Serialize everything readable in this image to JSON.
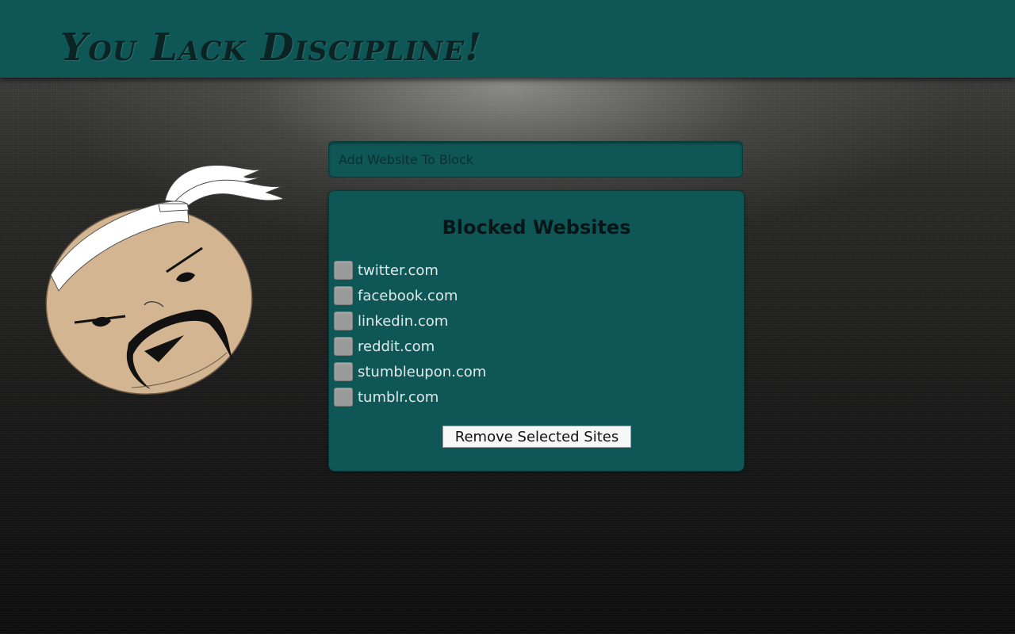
{
  "header": {
    "title": "You Lack Discipline!"
  },
  "mascot": {
    "icon": "angry-sensei-mascot-icon"
  },
  "add_site": {
    "placeholder": "Add Website To Block"
  },
  "blocked": {
    "title": "Blocked Websites",
    "sites": [
      {
        "label": "twitter.com",
        "checked": false
      },
      {
        "label": "facebook.com",
        "checked": false
      },
      {
        "label": "linkedin.com",
        "checked": false
      },
      {
        "label": "reddit.com",
        "checked": false
      },
      {
        "label": "stumbleupon.com",
        "checked": false
      },
      {
        "label": "tumblr.com",
        "checked": false
      }
    ],
    "remove_button_label": "Remove Selected Sites"
  },
  "colors": {
    "accent": "#0f5757",
    "title_text": "#0b2423",
    "face": "#d4b592"
  }
}
